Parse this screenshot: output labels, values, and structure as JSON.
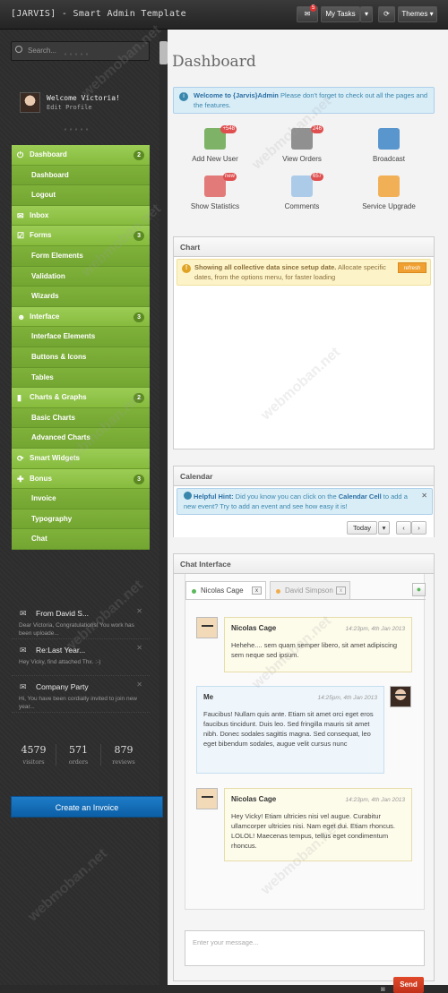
{
  "app": {
    "brand": "[JARVIS] - Smart Admin Template"
  },
  "topbar": {
    "my_tasks_label": "My Tasks",
    "themes_label": "Themes",
    "mail_badge": "5"
  },
  "sidebar": {
    "search_placeholder": "Search...",
    "user_greeting": "Welcome Victoria!",
    "user_edit": "Edit Profile",
    "nav": [
      {
        "label": "Dashboard",
        "type": "top",
        "icon": "power-icon",
        "count": "2"
      },
      {
        "label": "Dashboard",
        "type": "sub"
      },
      {
        "label": "Logout",
        "type": "sub"
      },
      {
        "label": "Inbox",
        "type": "top",
        "icon": "mail-icon"
      },
      {
        "label": "Forms",
        "type": "top",
        "icon": "check-icon",
        "count": "3"
      },
      {
        "label": "Form Elements",
        "type": "sub"
      },
      {
        "label": "Validation",
        "type": "sub"
      },
      {
        "label": "Wizards",
        "type": "sub"
      },
      {
        "label": "Interface",
        "type": "top",
        "icon": "user-icon",
        "count": "3"
      },
      {
        "label": "Interface Elements",
        "type": "sub"
      },
      {
        "label": "Buttons & Icons",
        "type": "sub"
      },
      {
        "label": "Tables",
        "type": "sub"
      },
      {
        "label": "Charts & Graphs",
        "type": "top",
        "icon": "bars-icon",
        "count": "2"
      },
      {
        "label": "Basic Charts",
        "type": "sub"
      },
      {
        "label": "Advanced Charts",
        "type": "sub"
      },
      {
        "label": "Smart Widgets",
        "type": "top",
        "icon": "refresh-icon"
      },
      {
        "label": "Bonus",
        "type": "top",
        "icon": "plus-icon",
        "count": "3"
      },
      {
        "label": "Invoice",
        "type": "sub"
      },
      {
        "label": "Typography",
        "type": "sub"
      },
      {
        "label": "Chat",
        "type": "sub"
      }
    ],
    "messages": [
      {
        "title": "From David S...",
        "body": "Dear Victoria, Congratulations! You work has been uploade...",
        "icon": "mail-icon"
      },
      {
        "title": "Re:Last Year...",
        "body": "Hey Vicky, find attached Thx. :-)",
        "icon": "mail-icon"
      },
      {
        "title": "Company Party",
        "body": "Hi, You have been cordially invited to join new year...",
        "icon": "mail-icon"
      }
    ],
    "stats": [
      {
        "value": "4579",
        "label": "visitors"
      },
      {
        "value": "571",
        "label": "orders"
      },
      {
        "value": "879",
        "label": "reviews"
      }
    ],
    "invoice_button": "Create an Invoice"
  },
  "main": {
    "page_title": "Dashboard",
    "welcome_alert": {
      "bold": "Welcome to {Jarvis}Admin",
      "text": " Please don't forget to check out all the pages and the features."
    },
    "shortcuts": [
      {
        "label": "Add New User",
        "badge": "+548",
        "icon": "add-user-icon"
      },
      {
        "label": "View Orders",
        "badge": "246",
        "icon": "orders-icon"
      },
      {
        "label": "Broadcast",
        "badge": "",
        "icon": "broadcast-icon"
      },
      {
        "label": "Show Statistics",
        "badge": "new",
        "icon": "statistics-icon"
      },
      {
        "label": "Comments",
        "badge": "657",
        "icon": "comments-icon"
      },
      {
        "label": "Service Upgrade",
        "badge": "",
        "icon": "upgrade-icon"
      }
    ],
    "chart_panel": {
      "title": "Chart",
      "alert_bold": "Showing all collective data since setup date.",
      "alert_text": " Allocate specific dates, from the options menu, for faster loading",
      "refresh_label": "refresh"
    },
    "calendar_panel": {
      "title": "Calendar",
      "hint_bold": "Helpful Hint:",
      "hint_text": " Did you know you can click on the ",
      "hint_bold2": "Calendar Cell",
      "hint_text2": " to add a new event? Try to add an event and see how easy it is!",
      "today_label": "Today"
    },
    "chat_panel": {
      "title": "Chat Interface",
      "tabs": [
        {
          "label": "Nicolas Cage",
          "status_color": "#5cb85c",
          "close": "x"
        },
        {
          "label": "David Simpson",
          "status_color": "#f0ad4e",
          "close": "x"
        }
      ],
      "messages": [
        {
          "name": "Nicolas Cage",
          "time": "14:23pm, 4th Jan 2013",
          "text": "Hehehe.... sem quam semper libero, sit amet adipiscing sem neque sed ipsum."
        },
        {
          "name": "Me",
          "time": "14:25pm, 4th Jan 2013",
          "text": "Faucibus! Nullam quis ante. Etiam sit amet orci eget eros faucibus tincidunt. Duis leo. Sed fringilla mauris sit amet nibh. Donec sodales sagittis magna. Sed consequat, leo eget bibendum sodales, augue velit cursus nunc"
        },
        {
          "name": "Nicolas Cage",
          "time": "14:23pm, 4th Jan 2013",
          "text": "Hey Vicky! Etiam ultricies nisi vel augue. Curabitur ullamcorper ultricies nisi. Nam eget dui. Etiam rhoncus. LOLOL! Maecenas tempus, tellus eget condimentum rhoncus."
        }
      ],
      "input_placeholder": "Enter your message...",
      "send_label": "Send"
    }
  },
  "watermark": "webmoban.net"
}
